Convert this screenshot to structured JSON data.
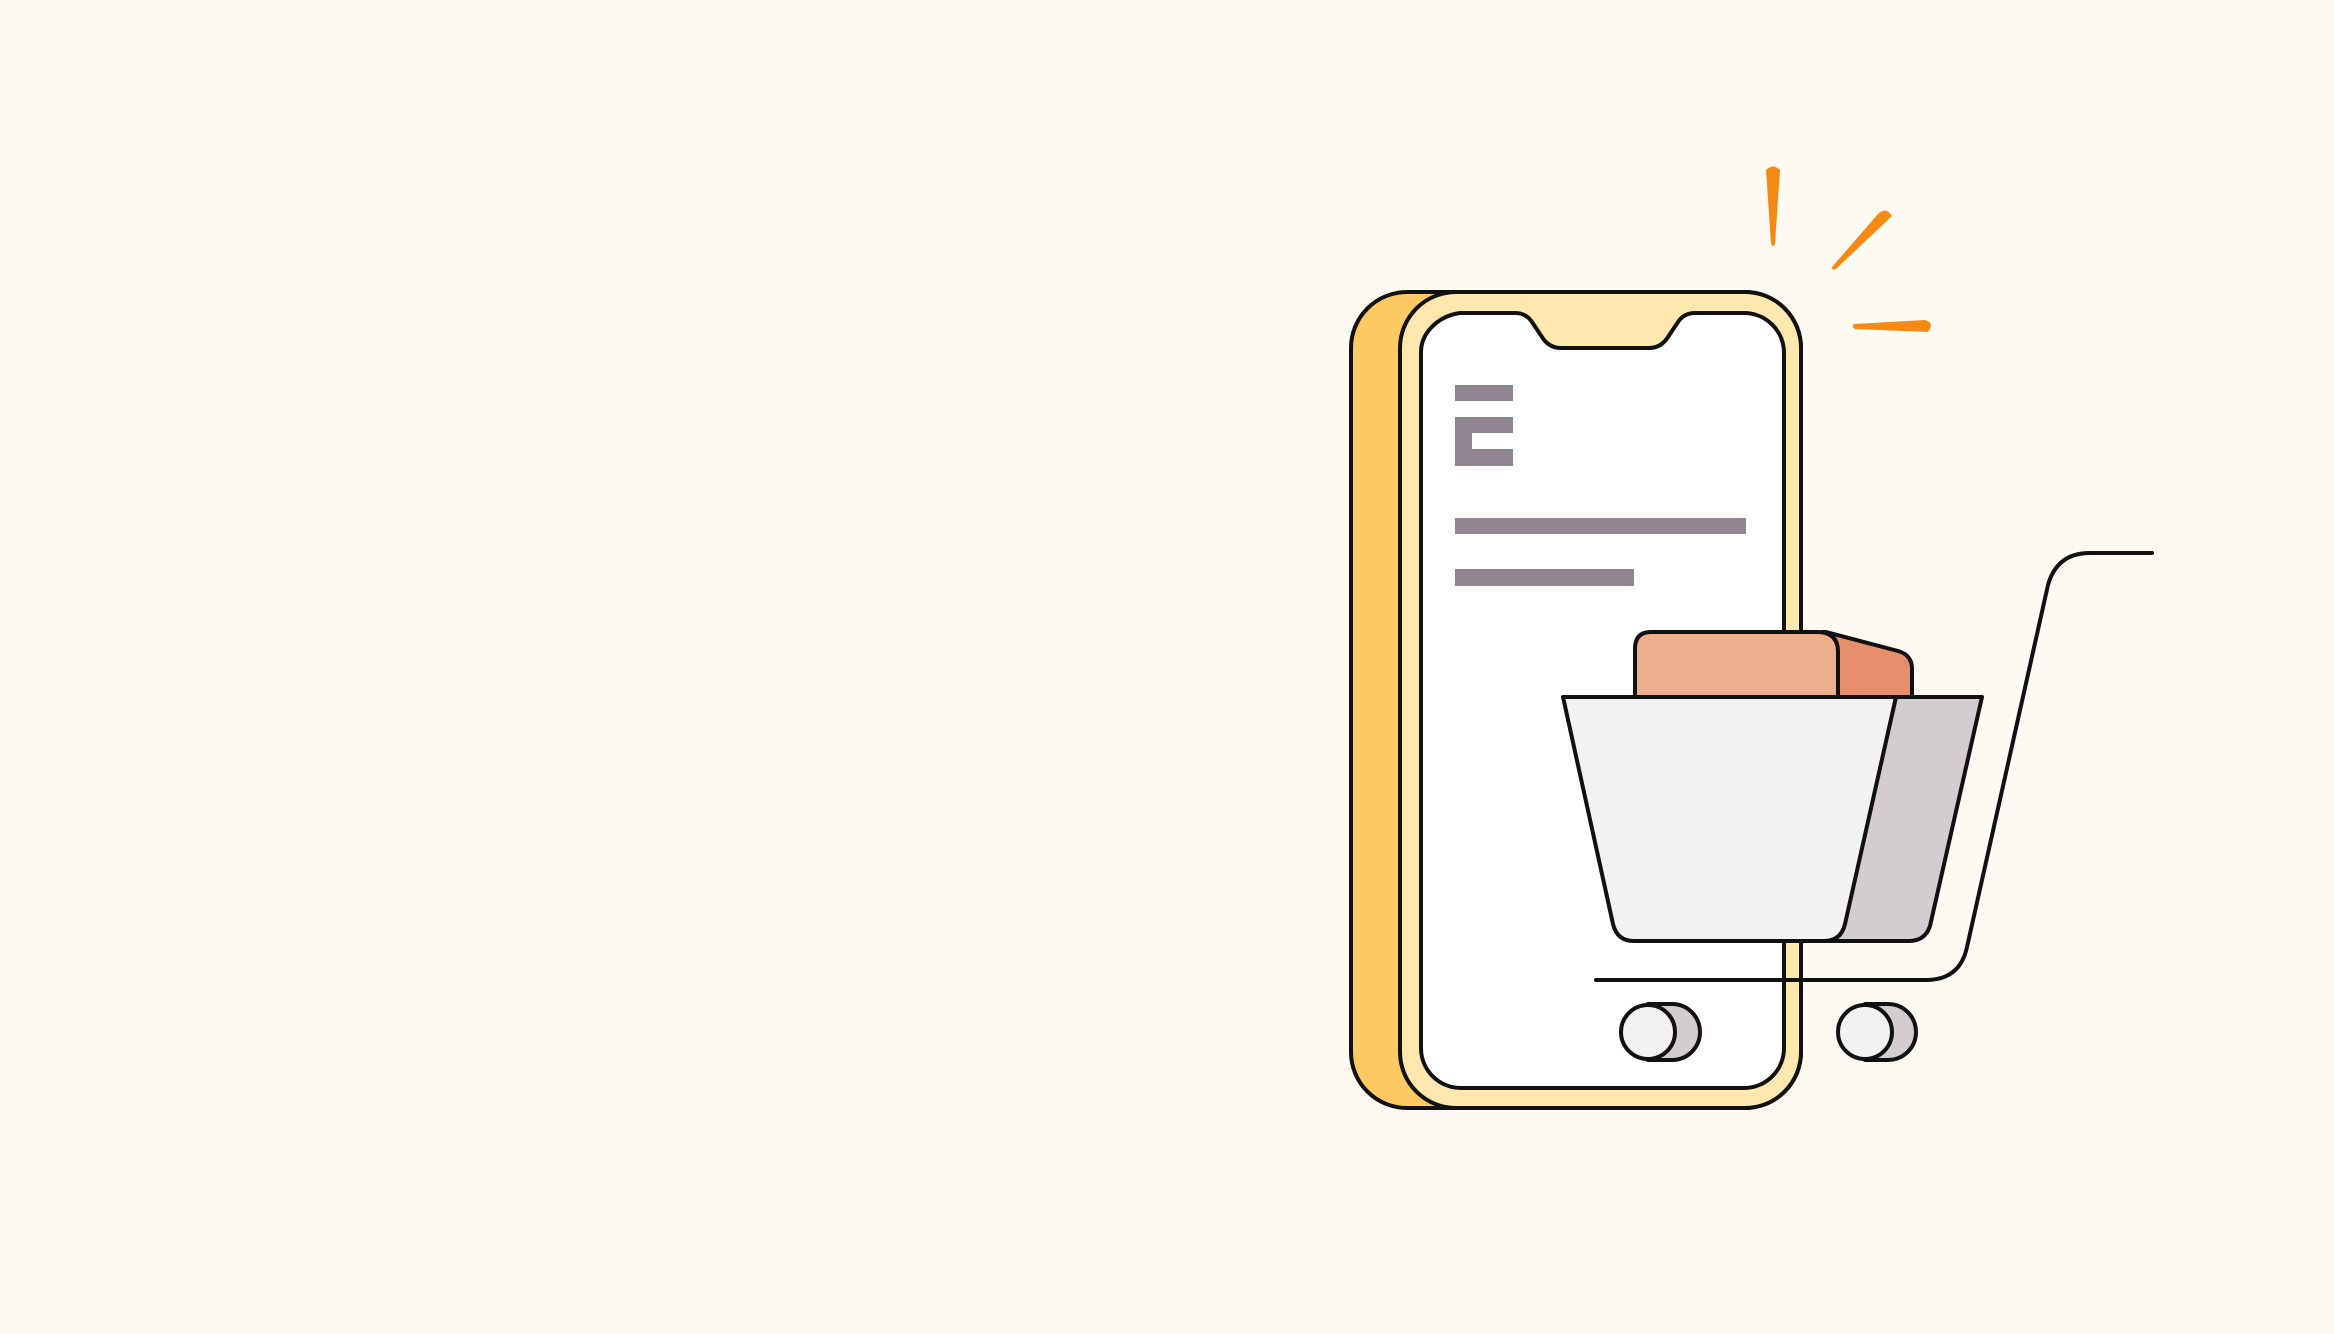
{
  "colors": {
    "background": "#FDFAF2",
    "outline": "#111111",
    "phone_back": "#FEC862",
    "phone_frame": "#FFE7AE",
    "phone_screen": "#FFFFFF",
    "screen_text_bars": "#918591",
    "spark": "#F48A14",
    "box_front": "#EFAE8B",
    "box_side": "#E78E6A",
    "basket_front": "#F2F2F2",
    "basket_side": "#D3CDCF",
    "wheel_fill": "#F2F2F2",
    "wheel_shadow": "#D3CDCF"
  },
  "icons": {
    "phone": "smartphone-icon",
    "cart": "shopping-cart-icon",
    "package": "package-icon",
    "spark": "spark-icon"
  }
}
